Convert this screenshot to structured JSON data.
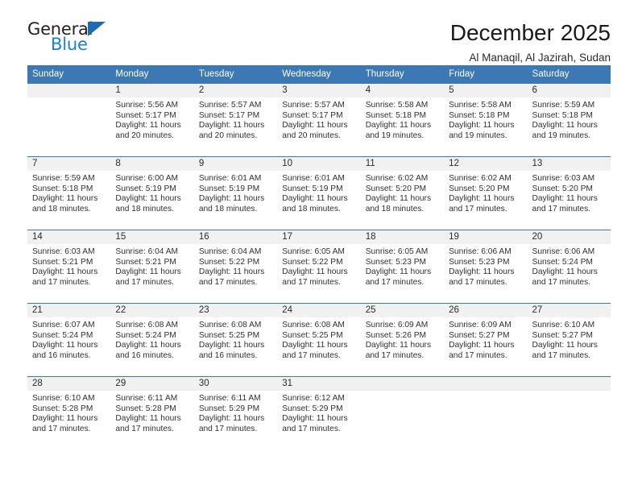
{
  "brand": {
    "name_top": "General",
    "name_bottom": "Blue",
    "triangle_color": "#1b6cb0",
    "blue_color": "#1c7fd4"
  },
  "header": {
    "title": "December 2025",
    "subtitle": "Al Manaqil, Al Jazirah, Sudan"
  },
  "theme": {
    "header_blue": "#3b78b4",
    "daynum_band": "#f1f1f1",
    "text": "#303030"
  },
  "calendar": {
    "weekday_headers": [
      "Sunday",
      "Monday",
      "Tuesday",
      "Wednesday",
      "Thursday",
      "Friday",
      "Saturday"
    ],
    "labels": {
      "sunrise_prefix": "Sunrise:",
      "sunset_prefix": "Sunset:",
      "daylight_prefix": "Daylight:"
    },
    "weeks": [
      [
        {
          "day": "",
          "empty": true
        },
        {
          "day": "1",
          "sunrise": "Sunrise: 5:56 AM",
          "sunset": "Sunset: 5:17 PM",
          "daylight1": "Daylight: 11 hours",
          "daylight2": "and 20 minutes."
        },
        {
          "day": "2",
          "sunrise": "Sunrise: 5:57 AM",
          "sunset": "Sunset: 5:17 PM",
          "daylight1": "Daylight: 11 hours",
          "daylight2": "and 20 minutes."
        },
        {
          "day": "3",
          "sunrise": "Sunrise: 5:57 AM",
          "sunset": "Sunset: 5:17 PM",
          "daylight1": "Daylight: 11 hours",
          "daylight2": "and 20 minutes."
        },
        {
          "day": "4",
          "sunrise": "Sunrise: 5:58 AM",
          "sunset": "Sunset: 5:18 PM",
          "daylight1": "Daylight: 11 hours",
          "daylight2": "and 19 minutes."
        },
        {
          "day": "5",
          "sunrise": "Sunrise: 5:58 AM",
          "sunset": "Sunset: 5:18 PM",
          "daylight1": "Daylight: 11 hours",
          "daylight2": "and 19 minutes."
        },
        {
          "day": "6",
          "sunrise": "Sunrise: 5:59 AM",
          "sunset": "Sunset: 5:18 PM",
          "daylight1": "Daylight: 11 hours",
          "daylight2": "and 19 minutes."
        }
      ],
      [
        {
          "day": "7",
          "sunrise": "Sunrise: 5:59 AM",
          "sunset": "Sunset: 5:18 PM",
          "daylight1": "Daylight: 11 hours",
          "daylight2": "and 18 minutes."
        },
        {
          "day": "8",
          "sunrise": "Sunrise: 6:00 AM",
          "sunset": "Sunset: 5:19 PM",
          "daylight1": "Daylight: 11 hours",
          "daylight2": "and 18 minutes."
        },
        {
          "day": "9",
          "sunrise": "Sunrise: 6:01 AM",
          "sunset": "Sunset: 5:19 PM",
          "daylight1": "Daylight: 11 hours",
          "daylight2": "and 18 minutes."
        },
        {
          "day": "10",
          "sunrise": "Sunrise: 6:01 AM",
          "sunset": "Sunset: 5:19 PM",
          "daylight1": "Daylight: 11 hours",
          "daylight2": "and 18 minutes."
        },
        {
          "day": "11",
          "sunrise": "Sunrise: 6:02 AM",
          "sunset": "Sunset: 5:20 PM",
          "daylight1": "Daylight: 11 hours",
          "daylight2": "and 18 minutes."
        },
        {
          "day": "12",
          "sunrise": "Sunrise: 6:02 AM",
          "sunset": "Sunset: 5:20 PM",
          "daylight1": "Daylight: 11 hours",
          "daylight2": "and 17 minutes."
        },
        {
          "day": "13",
          "sunrise": "Sunrise: 6:03 AM",
          "sunset": "Sunset: 5:20 PM",
          "daylight1": "Daylight: 11 hours",
          "daylight2": "and 17 minutes."
        }
      ],
      [
        {
          "day": "14",
          "sunrise": "Sunrise: 6:03 AM",
          "sunset": "Sunset: 5:21 PM",
          "daylight1": "Daylight: 11 hours",
          "daylight2": "and 17 minutes."
        },
        {
          "day": "15",
          "sunrise": "Sunrise: 6:04 AM",
          "sunset": "Sunset: 5:21 PM",
          "daylight1": "Daylight: 11 hours",
          "daylight2": "and 17 minutes."
        },
        {
          "day": "16",
          "sunrise": "Sunrise: 6:04 AM",
          "sunset": "Sunset: 5:22 PM",
          "daylight1": "Daylight: 11 hours",
          "daylight2": "and 17 minutes."
        },
        {
          "day": "17",
          "sunrise": "Sunrise: 6:05 AM",
          "sunset": "Sunset: 5:22 PM",
          "daylight1": "Daylight: 11 hours",
          "daylight2": "and 17 minutes."
        },
        {
          "day": "18",
          "sunrise": "Sunrise: 6:05 AM",
          "sunset": "Sunset: 5:23 PM",
          "daylight1": "Daylight: 11 hours",
          "daylight2": "and 17 minutes."
        },
        {
          "day": "19",
          "sunrise": "Sunrise: 6:06 AM",
          "sunset": "Sunset: 5:23 PM",
          "daylight1": "Daylight: 11 hours",
          "daylight2": "and 17 minutes."
        },
        {
          "day": "20",
          "sunrise": "Sunrise: 6:06 AM",
          "sunset": "Sunset: 5:24 PM",
          "daylight1": "Daylight: 11 hours",
          "daylight2": "and 17 minutes."
        }
      ],
      [
        {
          "day": "21",
          "sunrise": "Sunrise: 6:07 AM",
          "sunset": "Sunset: 5:24 PM",
          "daylight1": "Daylight: 11 hours",
          "daylight2": "and 16 minutes."
        },
        {
          "day": "22",
          "sunrise": "Sunrise: 6:08 AM",
          "sunset": "Sunset: 5:24 PM",
          "daylight1": "Daylight: 11 hours",
          "daylight2": "and 16 minutes."
        },
        {
          "day": "23",
          "sunrise": "Sunrise: 6:08 AM",
          "sunset": "Sunset: 5:25 PM",
          "daylight1": "Daylight: 11 hours",
          "daylight2": "and 16 minutes."
        },
        {
          "day": "24",
          "sunrise": "Sunrise: 6:08 AM",
          "sunset": "Sunset: 5:25 PM",
          "daylight1": "Daylight: 11 hours",
          "daylight2": "and 17 minutes."
        },
        {
          "day": "25",
          "sunrise": "Sunrise: 6:09 AM",
          "sunset": "Sunset: 5:26 PM",
          "daylight1": "Daylight: 11 hours",
          "daylight2": "and 17 minutes."
        },
        {
          "day": "26",
          "sunrise": "Sunrise: 6:09 AM",
          "sunset": "Sunset: 5:27 PM",
          "daylight1": "Daylight: 11 hours",
          "daylight2": "and 17 minutes."
        },
        {
          "day": "27",
          "sunrise": "Sunrise: 6:10 AM",
          "sunset": "Sunset: 5:27 PM",
          "daylight1": "Daylight: 11 hours",
          "daylight2": "and 17 minutes."
        }
      ],
      [
        {
          "day": "28",
          "sunrise": "Sunrise: 6:10 AM",
          "sunset": "Sunset: 5:28 PM",
          "daylight1": "Daylight: 11 hours",
          "daylight2": "and 17 minutes."
        },
        {
          "day": "29",
          "sunrise": "Sunrise: 6:11 AM",
          "sunset": "Sunset: 5:28 PM",
          "daylight1": "Daylight: 11 hours",
          "daylight2": "and 17 minutes."
        },
        {
          "day": "30",
          "sunrise": "Sunrise: 6:11 AM",
          "sunset": "Sunset: 5:29 PM",
          "daylight1": "Daylight: 11 hours",
          "daylight2": "and 17 minutes."
        },
        {
          "day": "31",
          "sunrise": "Sunrise: 6:12 AM",
          "sunset": "Sunset: 5:29 PM",
          "daylight1": "Daylight: 11 hours",
          "daylight2": "and 17 minutes."
        },
        {
          "day": "",
          "empty": true
        },
        {
          "day": "",
          "empty": true
        },
        {
          "day": "",
          "empty": true
        }
      ]
    ]
  }
}
